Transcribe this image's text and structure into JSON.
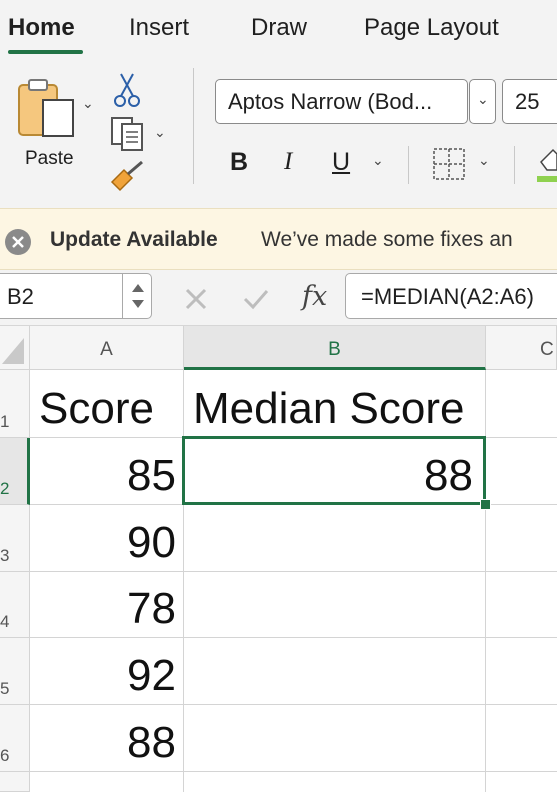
{
  "ribbon": {
    "tabs": [
      "Home",
      "Insert",
      "Draw",
      "Page Layout"
    ],
    "active_tab": "Home",
    "paste_label": "Paste",
    "font_name": "Aptos Narrow (Bod...",
    "font_size": "25",
    "bold_label": "B",
    "italic_label": "I",
    "underline_label": "U"
  },
  "message_bar": {
    "title": "Update Available",
    "body": "We’ve made some fixes an"
  },
  "formula_bar": {
    "name_box": "B2",
    "fx_label": "fx",
    "formula": "=MEDIAN(A2:A6)"
  },
  "grid": {
    "columns": [
      "A",
      "B",
      "C"
    ],
    "rows": [
      "1",
      "2",
      "3",
      "4",
      "5",
      "6"
    ],
    "selected_cell": "B2",
    "cells": {
      "A1": "Score",
      "B1": "Median Score",
      "A2": "85",
      "B2": "88",
      "A3": "90",
      "A4": "78",
      "A5": "92",
      "A6": "88"
    }
  },
  "colors": {
    "accent": "#217346",
    "message_bg": "#fdf6e3",
    "ribbon_bg": "#f3f3f3"
  }
}
